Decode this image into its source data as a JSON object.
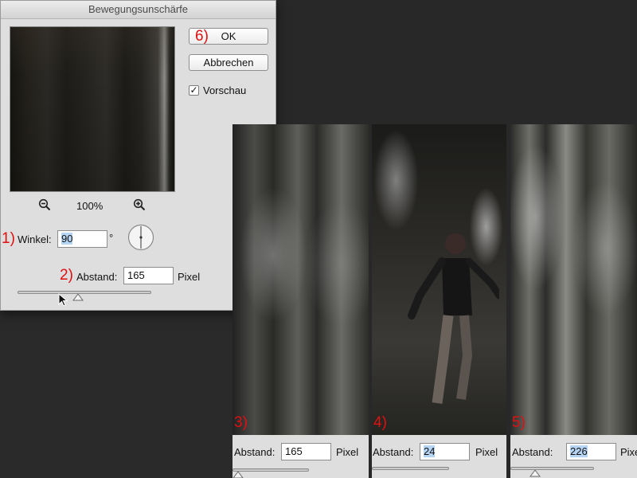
{
  "dialog": {
    "title": "Bewegungsunschärfe",
    "ok_label": "OK",
    "cancel_label": "Abbrechen",
    "preview_label": "Vorschau",
    "preview_checked": true,
    "zoom_level": "100%",
    "angle_label": "Winkel:",
    "angle_value": "90",
    "angle_unit": "°",
    "distance_label": "Abstand:",
    "distance_value": "165",
    "distance_unit": "Pixel"
  },
  "annotations": {
    "n1": "1)",
    "n2": "2)",
    "n3": "3)",
    "n4": "4)",
    "n5": "5)",
    "n6": "6)"
  },
  "strips": [
    {
      "label": "Abstand:",
      "value": "165",
      "unit": "Pixel"
    },
    {
      "label": "Abstand:",
      "value": "24",
      "unit": "Pixel"
    },
    {
      "label": "Abstand:",
      "value": "226",
      "unit": "Pixel"
    }
  ],
  "icons": {
    "zoom_out": "zoom-out-icon",
    "zoom_in": "zoom-in-icon",
    "checkmark": "checkmark-icon",
    "angle_dial": "angle-dial-icon",
    "slider_thumb": "slider-thumb-icon",
    "cursor": "mouse-cursor-icon"
  },
  "colors": {
    "annotation_red": "#e01010",
    "selection_blue": "#b6d4f4",
    "dialog_bg": "#dedede",
    "desktop_bg": "#282828"
  }
}
